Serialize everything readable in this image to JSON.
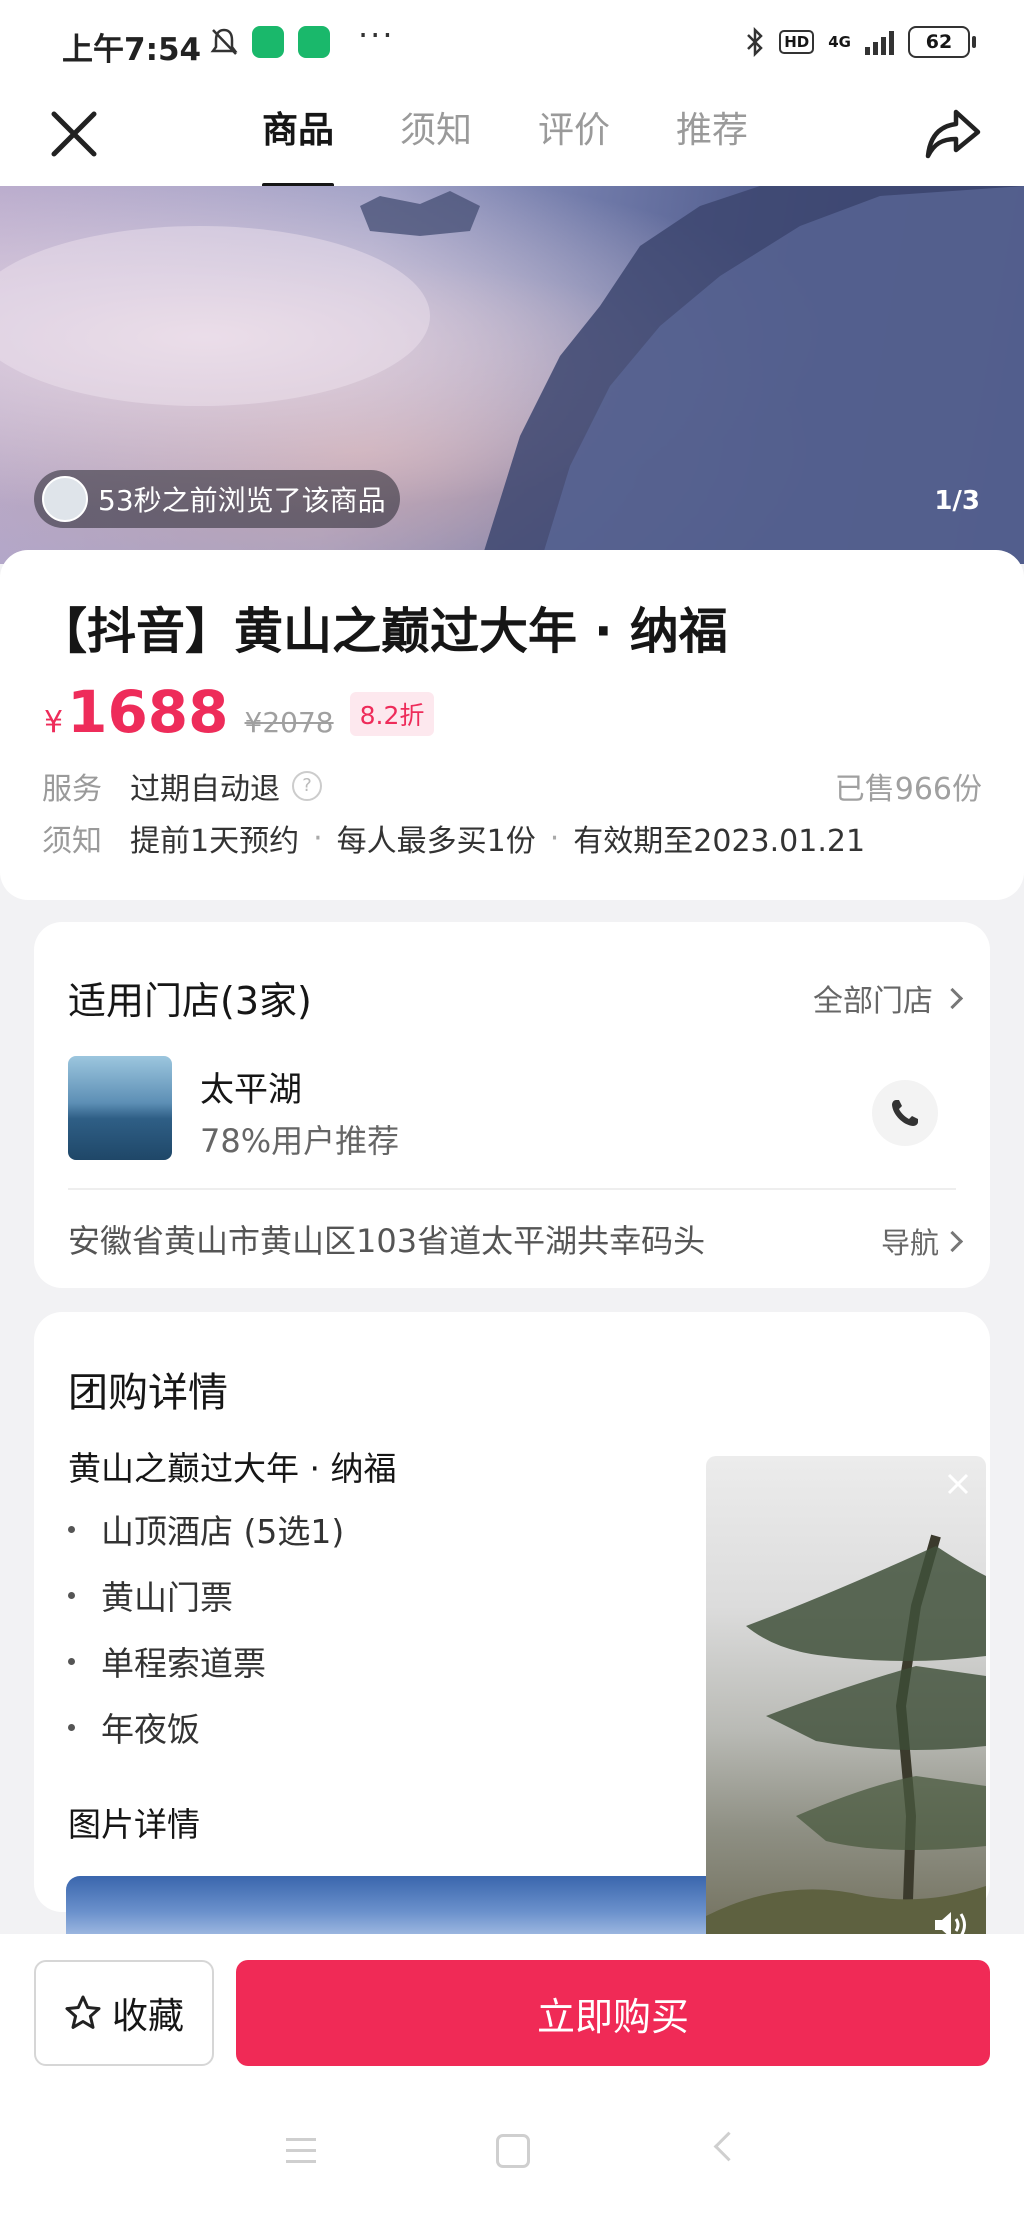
{
  "status_bar": {
    "time": "上午7:54",
    "hd": "HD",
    "network": "4G",
    "battery": "62",
    "more": "···"
  },
  "nav": {
    "tabs": [
      {
        "label": "商品",
        "active": true
      },
      {
        "label": "须知",
        "active": false
      },
      {
        "label": "评价",
        "active": false
      },
      {
        "label": "推荐",
        "active": false
      }
    ]
  },
  "hero": {
    "viewer_text": "53秒之前浏览了该商品",
    "counter": "1/3"
  },
  "product": {
    "title": "【抖音】黄山之巅过大年 · 纳福",
    "currency": "¥",
    "price": "1688",
    "original_price": "¥2078",
    "discount": "8.2折",
    "service_label": "服务",
    "service_value": "过期自动退",
    "sold": "已售966份",
    "notice_label": "须知",
    "notice_items": [
      "提前1天预约",
      "每人最多买1份",
      "有效期至2023.01.21"
    ],
    "separator": "·"
  },
  "stores": {
    "title": "适用门店(3家)",
    "all_link": "全部门店",
    "store_name": "太平湖",
    "recommend": "78%用户推荐",
    "address": "安徽省黄山市黄山区103省道太平湖共幸码头",
    "nav_link": "导航"
  },
  "deal": {
    "title": "团购详情",
    "package_name": "黄山之巅过大年 · 纳福",
    "items": [
      "山顶酒店 (5选1)",
      "黄山门票",
      "单程索道票",
      "年夜饭"
    ],
    "pic_title": "图片详情"
  },
  "bottom": {
    "favorite_label": "收藏",
    "buy_label": "立即购买"
  },
  "colors": {
    "accent": "#f02a56",
    "price": "#ee2c5a"
  },
  "icons": [
    "bell-mute-icon",
    "shield-icon",
    "bluetooth-icon",
    "signal-icon",
    "battery-icon",
    "close-icon",
    "share-icon",
    "phone-icon",
    "star-icon",
    "question-icon",
    "sound-icon"
  ]
}
